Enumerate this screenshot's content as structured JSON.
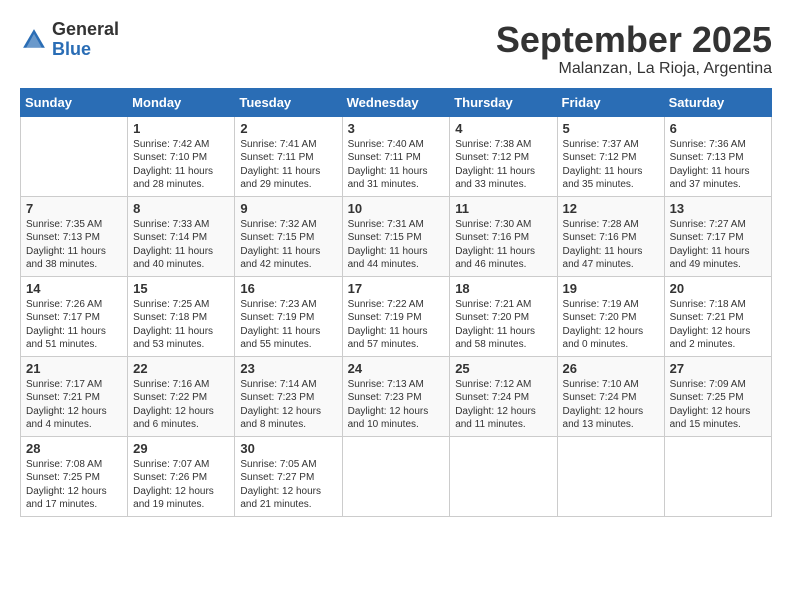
{
  "header": {
    "logo_general": "General",
    "logo_blue": "Blue",
    "month_title": "September 2025",
    "location": "Malanzan, La Rioja, Argentina"
  },
  "days_of_week": [
    "Sunday",
    "Monday",
    "Tuesday",
    "Wednesday",
    "Thursday",
    "Friday",
    "Saturday"
  ],
  "weeks": [
    [
      {
        "day": "",
        "content": ""
      },
      {
        "day": "1",
        "content": "Sunrise: 7:42 AM\nSunset: 7:10 PM\nDaylight: 11 hours\nand 28 minutes."
      },
      {
        "day": "2",
        "content": "Sunrise: 7:41 AM\nSunset: 7:11 PM\nDaylight: 11 hours\nand 29 minutes."
      },
      {
        "day": "3",
        "content": "Sunrise: 7:40 AM\nSunset: 7:11 PM\nDaylight: 11 hours\nand 31 minutes."
      },
      {
        "day": "4",
        "content": "Sunrise: 7:38 AM\nSunset: 7:12 PM\nDaylight: 11 hours\nand 33 minutes."
      },
      {
        "day": "5",
        "content": "Sunrise: 7:37 AM\nSunset: 7:12 PM\nDaylight: 11 hours\nand 35 minutes."
      },
      {
        "day": "6",
        "content": "Sunrise: 7:36 AM\nSunset: 7:13 PM\nDaylight: 11 hours\nand 37 minutes."
      }
    ],
    [
      {
        "day": "7",
        "content": "Sunrise: 7:35 AM\nSunset: 7:13 PM\nDaylight: 11 hours\nand 38 minutes."
      },
      {
        "day": "8",
        "content": "Sunrise: 7:33 AM\nSunset: 7:14 PM\nDaylight: 11 hours\nand 40 minutes."
      },
      {
        "day": "9",
        "content": "Sunrise: 7:32 AM\nSunset: 7:15 PM\nDaylight: 11 hours\nand 42 minutes."
      },
      {
        "day": "10",
        "content": "Sunrise: 7:31 AM\nSunset: 7:15 PM\nDaylight: 11 hours\nand 44 minutes."
      },
      {
        "day": "11",
        "content": "Sunrise: 7:30 AM\nSunset: 7:16 PM\nDaylight: 11 hours\nand 46 minutes."
      },
      {
        "day": "12",
        "content": "Sunrise: 7:28 AM\nSunset: 7:16 PM\nDaylight: 11 hours\nand 47 minutes."
      },
      {
        "day": "13",
        "content": "Sunrise: 7:27 AM\nSunset: 7:17 PM\nDaylight: 11 hours\nand 49 minutes."
      }
    ],
    [
      {
        "day": "14",
        "content": "Sunrise: 7:26 AM\nSunset: 7:17 PM\nDaylight: 11 hours\nand 51 minutes."
      },
      {
        "day": "15",
        "content": "Sunrise: 7:25 AM\nSunset: 7:18 PM\nDaylight: 11 hours\nand 53 minutes."
      },
      {
        "day": "16",
        "content": "Sunrise: 7:23 AM\nSunset: 7:19 PM\nDaylight: 11 hours\nand 55 minutes."
      },
      {
        "day": "17",
        "content": "Sunrise: 7:22 AM\nSunset: 7:19 PM\nDaylight: 11 hours\nand 57 minutes."
      },
      {
        "day": "18",
        "content": "Sunrise: 7:21 AM\nSunset: 7:20 PM\nDaylight: 11 hours\nand 58 minutes."
      },
      {
        "day": "19",
        "content": "Sunrise: 7:19 AM\nSunset: 7:20 PM\nDaylight: 12 hours\nand 0 minutes."
      },
      {
        "day": "20",
        "content": "Sunrise: 7:18 AM\nSunset: 7:21 PM\nDaylight: 12 hours\nand 2 minutes."
      }
    ],
    [
      {
        "day": "21",
        "content": "Sunrise: 7:17 AM\nSunset: 7:21 PM\nDaylight: 12 hours\nand 4 minutes."
      },
      {
        "day": "22",
        "content": "Sunrise: 7:16 AM\nSunset: 7:22 PM\nDaylight: 12 hours\nand 6 minutes."
      },
      {
        "day": "23",
        "content": "Sunrise: 7:14 AM\nSunset: 7:23 PM\nDaylight: 12 hours\nand 8 minutes."
      },
      {
        "day": "24",
        "content": "Sunrise: 7:13 AM\nSunset: 7:23 PM\nDaylight: 12 hours\nand 10 minutes."
      },
      {
        "day": "25",
        "content": "Sunrise: 7:12 AM\nSunset: 7:24 PM\nDaylight: 12 hours\nand 11 minutes."
      },
      {
        "day": "26",
        "content": "Sunrise: 7:10 AM\nSunset: 7:24 PM\nDaylight: 12 hours\nand 13 minutes."
      },
      {
        "day": "27",
        "content": "Sunrise: 7:09 AM\nSunset: 7:25 PM\nDaylight: 12 hours\nand 15 minutes."
      }
    ],
    [
      {
        "day": "28",
        "content": "Sunrise: 7:08 AM\nSunset: 7:25 PM\nDaylight: 12 hours\nand 17 minutes."
      },
      {
        "day": "29",
        "content": "Sunrise: 7:07 AM\nSunset: 7:26 PM\nDaylight: 12 hours\nand 19 minutes."
      },
      {
        "day": "30",
        "content": "Sunrise: 7:05 AM\nSunset: 7:27 PM\nDaylight: 12 hours\nand 21 minutes."
      },
      {
        "day": "",
        "content": ""
      },
      {
        "day": "",
        "content": ""
      },
      {
        "day": "",
        "content": ""
      },
      {
        "day": "",
        "content": ""
      }
    ]
  ]
}
